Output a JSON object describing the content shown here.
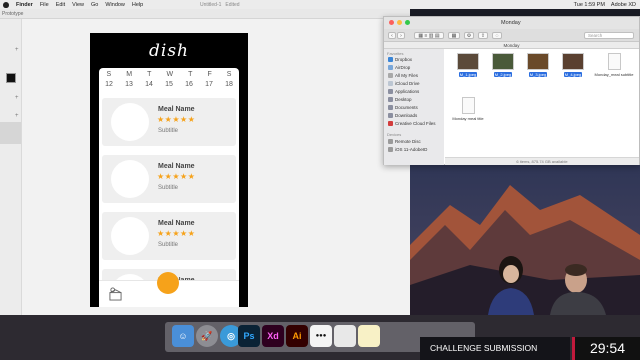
{
  "menubar": {
    "app_name": "Finder",
    "items": [
      "File",
      "Edit",
      "View",
      "Go",
      "Window",
      "Help"
    ],
    "doc_title": "Untitled-1",
    "doc_status": "Edited",
    "clock": "Tue 1:59 PM",
    "app_label": "Adobe XD"
  },
  "xd": {
    "tab_label": "Prototype"
  },
  "app": {
    "logo": "dish",
    "weekdays": [
      "S",
      "M",
      "T",
      "W",
      "T",
      "F",
      "S"
    ],
    "dates": [
      "12",
      "13",
      "14",
      "15",
      "16",
      "17",
      "18"
    ],
    "cards": [
      {
        "name": "Meal Name",
        "rating": 5,
        "subtitle": "Subtitle"
      },
      {
        "name": "Meal Name",
        "rating": 5,
        "subtitle": "Subtitle"
      },
      {
        "name": "Meal Name",
        "rating": 5,
        "subtitle": "Subtitle"
      }
    ],
    "partial_card_name": "Meal Name",
    "accent_color": "#f6a21a",
    "tab_icon": "box-icon",
    "fab_icon": "orange-circle"
  },
  "finder": {
    "title": "Monday",
    "path": "Monday",
    "search_placeholder": "Search",
    "favorites_heading": "Favorites",
    "favorites": [
      "Dropbox",
      "AirDrop",
      "All My Files",
      "iCloud Drive",
      "Applications",
      "Desktop",
      "Documents",
      "Downloads",
      "Creative Cloud Files"
    ],
    "devices_heading": "Devices",
    "devices": [
      "Remote Disc",
      "iOS 11-AdobeID"
    ],
    "files": [
      {
        "name": "M_1.jpeg",
        "selected": true,
        "kind": "image"
      },
      {
        "name": "M_2.jpeg",
        "selected": true,
        "kind": "image"
      },
      {
        "name": "M_3.jpeg",
        "selected": true,
        "kind": "image"
      },
      {
        "name": "M_4.jpeg",
        "selected": true,
        "kind": "image"
      },
      {
        "name": "Monday_meal subtitle",
        "selected": false,
        "kind": "text"
      },
      {
        "name": "Monday meal title",
        "selected": false,
        "kind": "text"
      }
    ],
    "status": "6 items, 875.74 GB available"
  },
  "dock": {
    "apps": [
      "Finder",
      "Launchpad",
      "Safari",
      "Photoshop",
      "Adobe XD",
      "Illustrator",
      "Tinder",
      "Preview",
      "Notes"
    ],
    "app_labels": {
      "ps": "Ps",
      "xd": "Xd",
      "ai": "Ai"
    }
  },
  "overlay": {
    "banner": "CHALLENGE SUBMISSION DEADLINE",
    "timer": "29:54",
    "timer_accent": "#c21a3c"
  }
}
